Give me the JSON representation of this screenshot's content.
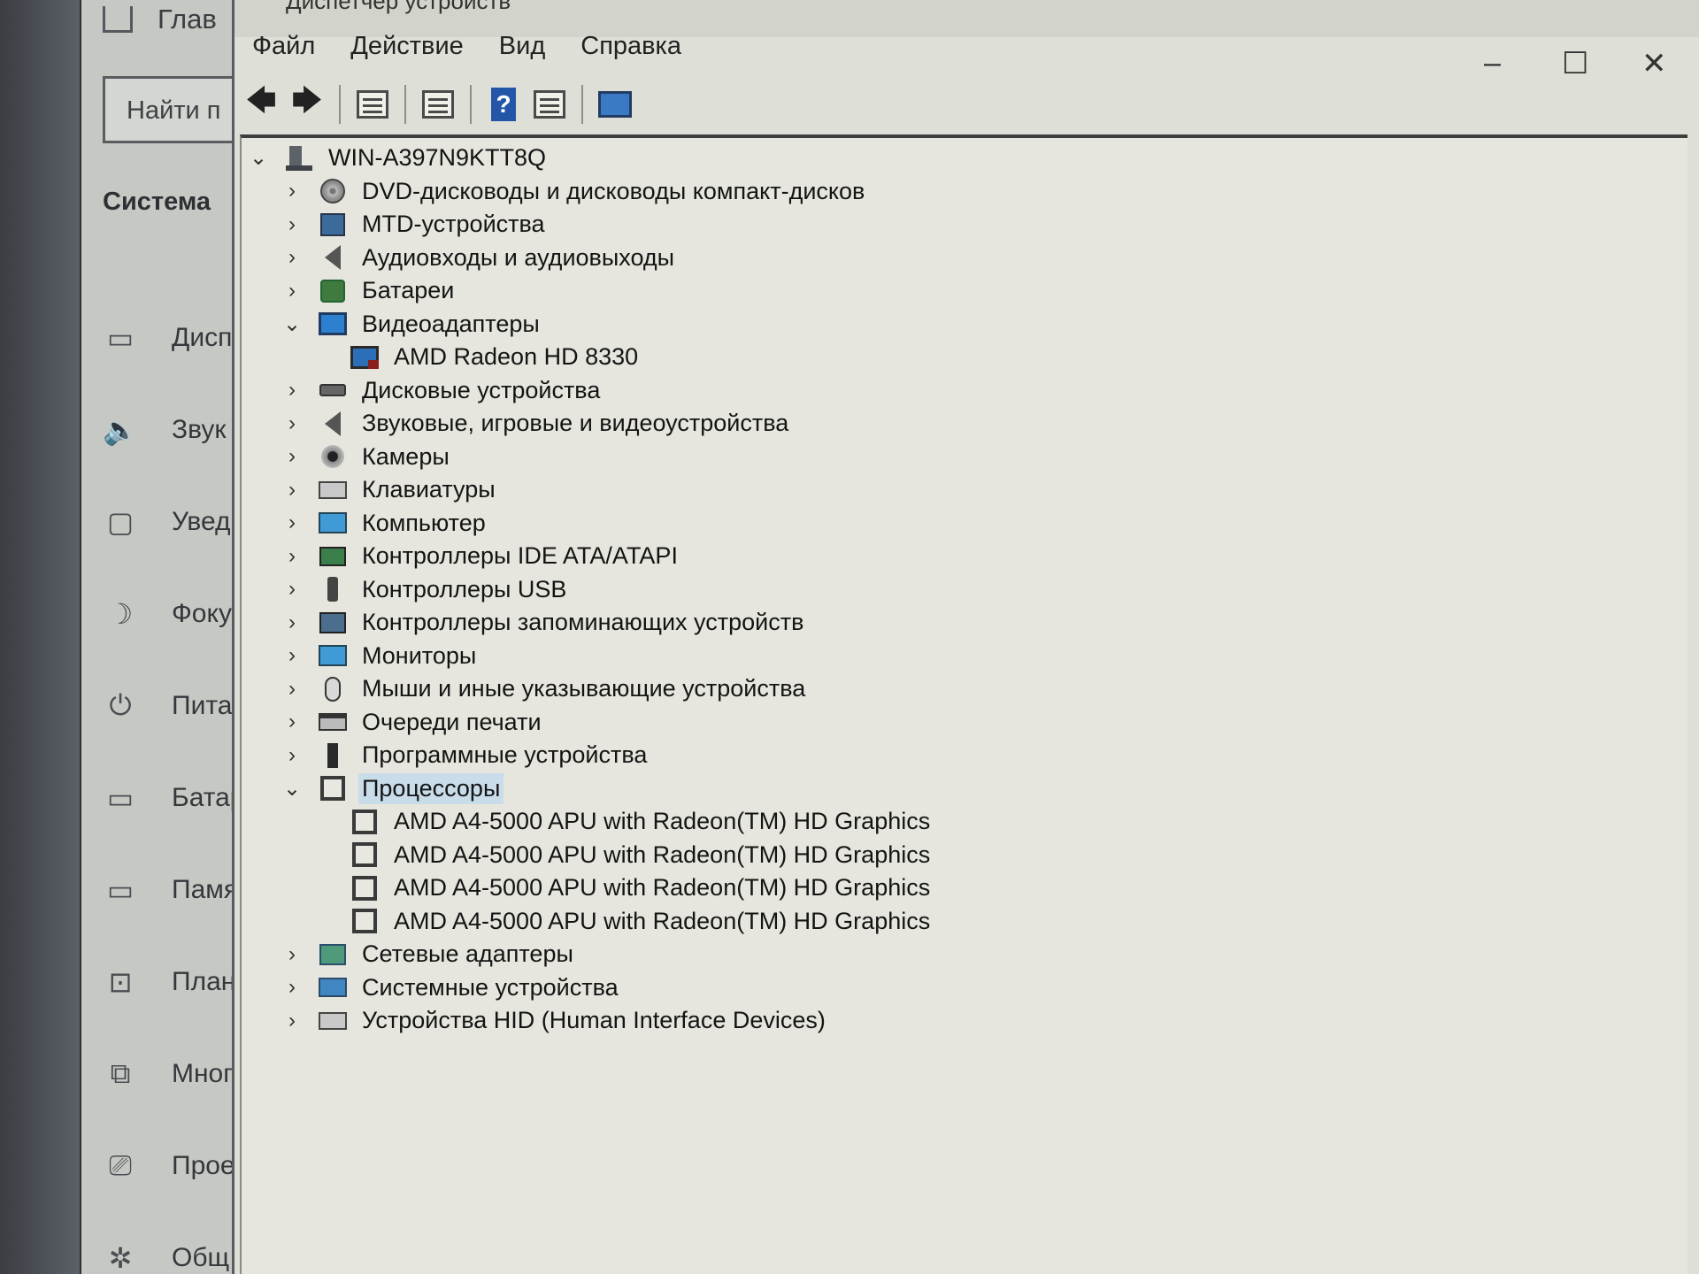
{
  "settings": {
    "home_label": "Глав",
    "search_placeholder": "Найти п",
    "section_title": "Система",
    "nav_items": [
      {
        "icon": "display-icon",
        "glyph": "▭",
        "label": "Дисп"
      },
      {
        "icon": "sound-icon",
        "glyph": "🔈",
        "label": "Звук"
      },
      {
        "icon": "notifications-icon",
        "glyph": "▢",
        "label": "Увед"
      },
      {
        "icon": "focus-assist-icon",
        "glyph": "☽",
        "label": "Фоку"
      },
      {
        "icon": "power-icon",
        "glyph": "⏻",
        "label": "Пита"
      },
      {
        "icon": "battery-icon",
        "glyph": "▭",
        "label": "Батар"
      },
      {
        "icon": "storage-icon",
        "glyph": "▭",
        "label": "Памя"
      },
      {
        "icon": "tablet-icon",
        "glyph": "⊡",
        "label": "План"
      },
      {
        "icon": "multitasking-icon",
        "glyph": "⧉",
        "label": "Мног"
      },
      {
        "icon": "projecting-icon",
        "glyph": "⎚",
        "label": "Прое"
      },
      {
        "icon": "shared-experiences-icon",
        "glyph": "✲",
        "label": "Общ"
      }
    ]
  },
  "device_manager": {
    "title": "Диспетчер устройств",
    "menu": [
      "Файл",
      "Действие",
      "Вид",
      "Справка"
    ],
    "window_controls": {
      "minimize": "–",
      "maximize": "☐",
      "close": "✕"
    },
    "toolbar": {
      "back": "🡄",
      "forward": "🡆",
      "help": "?"
    },
    "tree": {
      "root": "WIN-A397N9KTT8Q",
      "categories": [
        {
          "label": "DVD-дисководы и дисководы компакт-дисков",
          "icon": "dvd-drive-icon",
          "glyph": "i-disc",
          "expanded": false,
          "children": []
        },
        {
          "label": "MTD-устройства",
          "icon": "mtd-device-icon",
          "glyph": "i-square",
          "expanded": false,
          "children": []
        },
        {
          "label": "Аудиовходы и аудиовыходы",
          "icon": "audio-io-icon",
          "glyph": "i-speaker",
          "expanded": false,
          "children": []
        },
        {
          "label": "Батареи",
          "icon": "battery-icon",
          "glyph": "i-battery",
          "expanded": false,
          "children": []
        },
        {
          "label": "Видеоадаптеры",
          "icon": "display-adapter-icon",
          "glyph": "i-display",
          "expanded": true,
          "children": [
            "AMD Radeon HD 8330"
          ],
          "child_icon": "i-gpu"
        },
        {
          "label": "Дисковые устройства",
          "icon": "disk-drive-icon",
          "glyph": "i-drive",
          "expanded": false,
          "children": []
        },
        {
          "label": "Звуковые, игровые и видеоустройства",
          "icon": "sound-video-icon",
          "glyph": "i-speaker",
          "expanded": false,
          "children": []
        },
        {
          "label": "Камеры",
          "icon": "camera-icon",
          "glyph": "i-camera",
          "expanded": false,
          "children": []
        },
        {
          "label": "Клавиатуры",
          "icon": "keyboard-icon",
          "glyph": "i-keyboard",
          "expanded": false,
          "children": []
        },
        {
          "label": "Компьютер",
          "icon": "computer-icon",
          "glyph": "i-mon",
          "expanded": false,
          "children": []
        },
        {
          "label": "Контроллеры IDE ATA/ATAPI",
          "icon": "ide-controller-icon",
          "glyph": "i-ide",
          "expanded": false,
          "children": []
        },
        {
          "label": "Контроллеры USB",
          "icon": "usb-controller-icon",
          "glyph": "i-usb",
          "expanded": false,
          "children": []
        },
        {
          "label": "Контроллеры запоминающих устройств",
          "icon": "storage-controller-icon",
          "glyph": "i-storage",
          "expanded": false,
          "children": []
        },
        {
          "label": "Мониторы",
          "icon": "monitor-icon",
          "glyph": "i-mon",
          "expanded": false,
          "children": []
        },
        {
          "label": "Мыши и иные указывающие устройства",
          "icon": "mouse-icon",
          "glyph": "i-mouse",
          "expanded": false,
          "children": []
        },
        {
          "label": "Очереди печати",
          "icon": "print-queue-icon",
          "glyph": "i-printer",
          "expanded": false,
          "children": []
        },
        {
          "label": "Программные устройства",
          "icon": "software-device-icon",
          "glyph": "i-soft",
          "expanded": false,
          "children": []
        },
        {
          "label": "Процессоры",
          "icon": "processor-icon",
          "glyph": "i-cpu",
          "expanded": true,
          "selected": true,
          "children": [
            "AMD A4-5000 APU with Radeon(TM) HD Graphics",
            "AMD A4-5000 APU with Radeon(TM) HD Graphics",
            "AMD A4-5000 APU with Radeon(TM) HD Graphics",
            "AMD A4-5000 APU with Radeon(TM) HD Graphics"
          ],
          "child_icon": "i-cpu"
        },
        {
          "label": "Сетевые адаптеры",
          "icon": "network-adapter-icon",
          "glyph": "i-net",
          "expanded": false,
          "children": []
        },
        {
          "label": "Системные устройства",
          "icon": "system-device-icon",
          "glyph": "i-sys",
          "expanded": false,
          "children": []
        },
        {
          "label": "Устройства HID (Human Interface Devices)",
          "icon": "hid-icon",
          "glyph": "i-hid",
          "expanded": false,
          "children": []
        }
      ]
    }
  }
}
